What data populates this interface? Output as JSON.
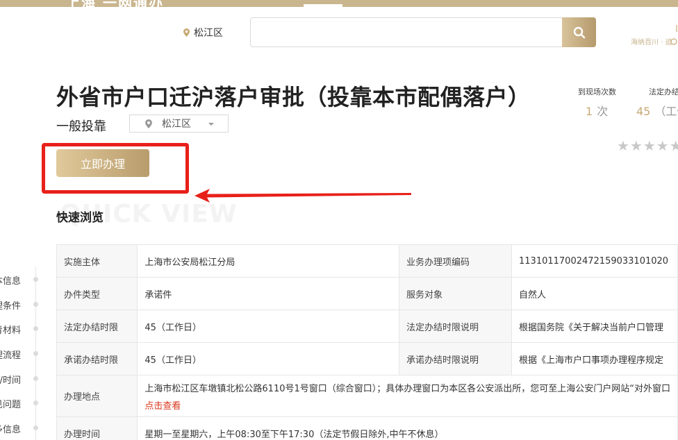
{
  "header": {
    "logo": "上海 一网通办",
    "location": "松江区",
    "search": {
      "placeholder": ""
    },
    "slogan": "海纳百川 · 追"
  },
  "page": {
    "title": "外省市户口迁沪落户审批（投靠本市配偶落户）",
    "subtitle": "一般投靠",
    "district": "松江区",
    "apply_label": "立即办理",
    "stats": [
      {
        "label": "到现场次数",
        "value": "1",
        "unit": "次"
      },
      {
        "label": "法定办结",
        "value": "45",
        "unit": "（工作"
      }
    ],
    "stars": "★★★★★",
    "rating_stars_shown": 5
  },
  "quick_view": {
    "title": "快速浏览",
    "bg_text": "QUICK VIEW"
  },
  "side_nav": [
    "本信息",
    "理条件",
    "青材料",
    "理流程",
    "/时间",
    "见问题",
    "多信息"
  ],
  "table": {
    "rows": [
      {
        "l1": "实施主体",
        "v1": "上海市公安局松江分局",
        "l2": "业务办理项编码",
        "v2": "11310117002472159033101020"
      },
      {
        "l1": "办件类型",
        "v1": "承诺件",
        "l2": "服务对象",
        "v2": "自然人"
      },
      {
        "l1": "法定办结时限",
        "v1": "45（工作日）",
        "l2": "法定办结时限说明",
        "v2": "根据国务院《关于解决当前户口管理"
      },
      {
        "l1": "承诺办结时限",
        "v1": "45（工作日）",
        "l2": "承诺办结时限说明",
        "v2": "根据《上海市户口事项办理程序规定"
      }
    ],
    "location_row": {
      "label": "办理地点",
      "value": "上海市松江区车墩镇北松公路6110号1号窗口（综合窗口）；具体办理窗口为本区各公安派出所，您可至上海公安门户网站“对外窗口",
      "link": "点击查看"
    },
    "time_row": {
      "label": "办理时间",
      "value": "星期一至星期六，上午08:30至下午17:30（法定节假日除外,中午不休息）"
    }
  },
  "colors": {
    "gold": "#c8aa76",
    "highlight": "#e8201a",
    "link_red": "#d9361d"
  }
}
